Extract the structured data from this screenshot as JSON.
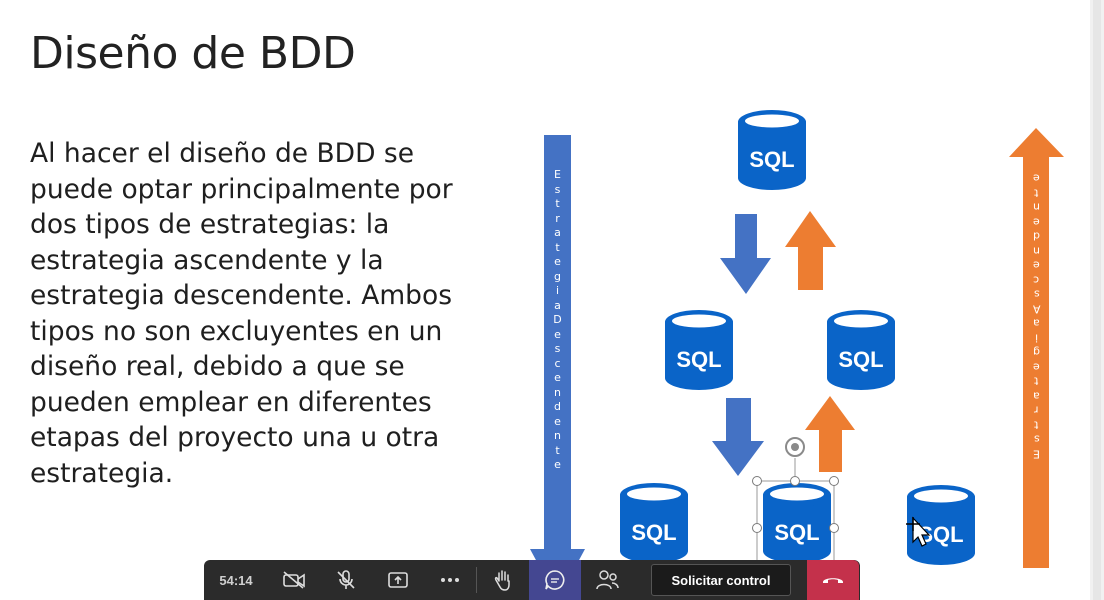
{
  "slide": {
    "title": "Diseño de BDD",
    "body": "Al hacer el diseño de BDD se puede optar principalmente por dos tipos de estrategias: la estrategia ascendente y la estrategia descendente. Ambos tipos no son excluyentes en un diseño real, debido a que se pueden emplear en diferentes etapas del proyecto una u otra estrategia."
  },
  "diagram": {
    "db_label": "SQL",
    "left_arrow_label": "EstrategiaDescendente",
    "right_arrow_label": "EstrategiaAscendente",
    "colors": {
      "blue": "#4472c4",
      "orange": "#ed7d31",
      "db": "#0a64c8"
    }
  },
  "toolbar": {
    "timer": "54:14",
    "icons": [
      "camera-off-icon",
      "mic-off-icon",
      "share-icon",
      "more-icon",
      "raise-hand-icon",
      "chat-icon",
      "people-icon"
    ],
    "request_control": "Solicitar control",
    "hangup_icon": "phone-hangup-icon"
  }
}
